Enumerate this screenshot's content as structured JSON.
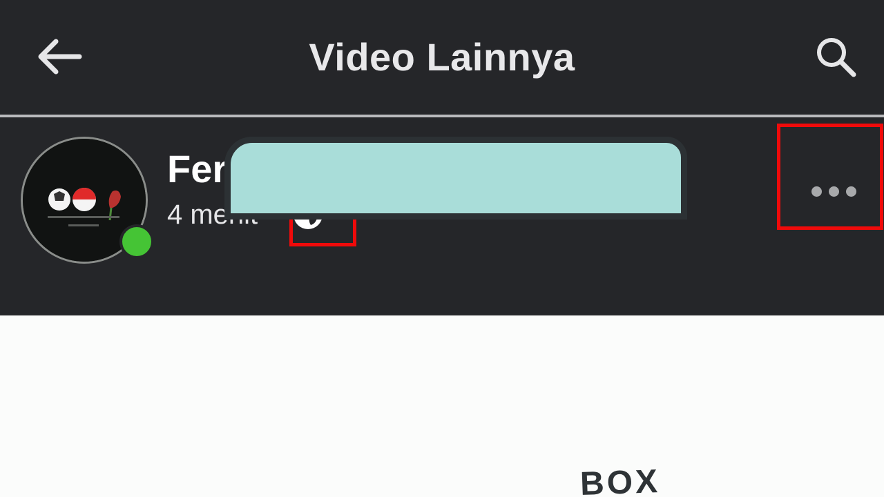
{
  "app_bar": {
    "title": "Video Lainnya",
    "back_icon": "arrow-left-icon",
    "search_icon": "search-icon"
  },
  "post": {
    "author": "Ferry Ayunda",
    "time": "4 menit",
    "separator": "·",
    "privacy_icon": "globe-icon",
    "more_icon": "more-horizontal-icon",
    "online": true
  },
  "video": {
    "label": "BOX"
  },
  "colors": {
    "bar_background": "#252629",
    "title_text": "#e8e8ea",
    "online_green": "#45c435",
    "highlight_red": "#f00a0a",
    "video_box_fill": "#a9ddd9"
  }
}
